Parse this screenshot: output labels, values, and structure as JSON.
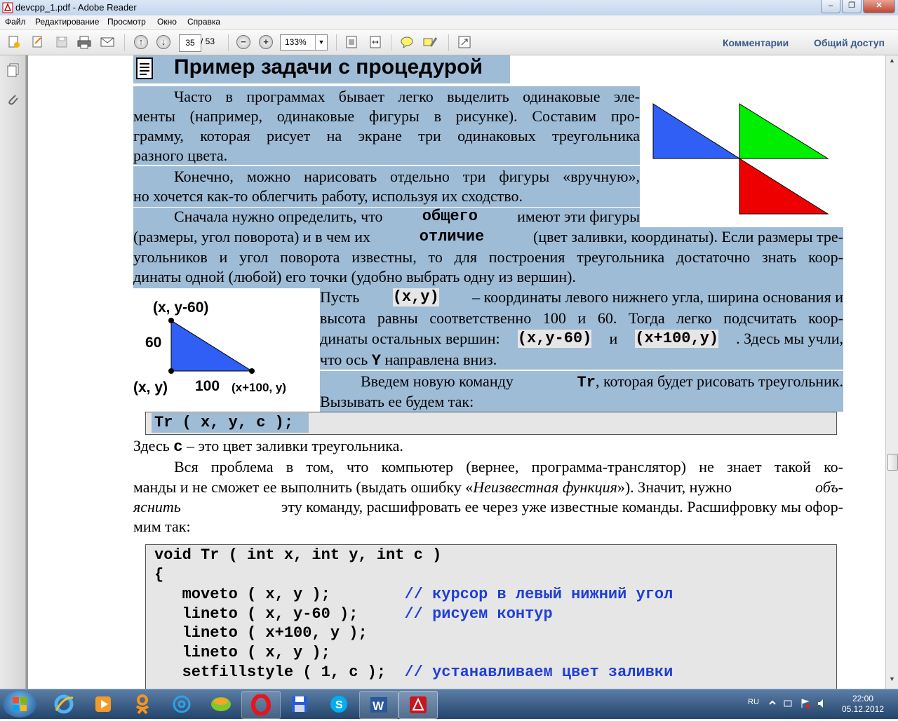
{
  "window": {
    "title": "devcpp_1.pdf - Adobe Reader"
  },
  "menu": [
    "Файл",
    "Редактирование",
    "Просмотр",
    "Окно",
    "Справка"
  ],
  "toolbar": {
    "page_current": "35",
    "page_total": "/ 53",
    "zoom": "133%",
    "comments_label": "Комментарии",
    "share_label": "Общий доступ"
  },
  "document": {
    "heading": "Пример задачи с процедурой",
    "para1": [
      "Часто  в программах бывает легко выделить одинаковые эле-",
      "менты (например, одинаковые фигуры в рисунке). Составим про-",
      "грамму, которая рисует на экране три одинаковых треугольника",
      "разного цвета."
    ],
    "para2": [
      "Конечно, можно нарисовать отдельно три фигуры «вручную»,",
      "но хочется как-то облегчить работу, используя их сходство."
    ],
    "para3": {
      "l1_a": "Сначала нужно определить, что",
      "l1_b": "общего",
      "l1_c": "имеют эти фигуры",
      "l2_a": "(размеры, угол поворота) и в чем их",
      "l2_b": "отличие",
      "l2_c": "(цвет заливки, координаты). Если размеры тре-",
      "l3": "угольников и угол поворота известны, то для построения треугольника достаточно знать коор-",
      "l4": "динаты одной (любой) его точки (удобно выбрать одну из вершин)."
    },
    "diagram": {
      "top_label": "(x, y-60)",
      "height_label": "60",
      "bl_label": "(x, y)",
      "width_label": "100",
      "br_label": "(x+100, y)"
    },
    "para4": {
      "l1_a": "Пусть",
      "l1_code": "(x,y)",
      "l1_b": "– координаты левого нижнего угла, ширина основания и",
      "l2": "высота равны соответственно 100 и 60.  Тогда легко подсчитать коор-",
      "l3_a": "динаты остальных вершин:",
      "l3_code1": "(x,y-60)",
      "l3_b": "и",
      "l3_code2": "(x+100,y)",
      "l3_c": ". Здесь мы учли,",
      "l4_a": "что ось",
      "l4_code": "Y",
      "l4_b": "направлена вниз."
    },
    "para5": {
      "l1_a": "Введем новую команду",
      "l1_code": "Tr",
      "l1_b": ", которая будет рисовать треугольник.",
      "l2": "Вызывать ее будем так:"
    },
    "call_code": "Tr ( x, y, c );",
    "para6": {
      "a": "Здесь",
      "code": "c",
      "b": "– это цвет заливки треугольника."
    },
    "para7": {
      "l1": "Вся проблема в том, что компьютер (вернее, программа-транслятор) не знает такой ко-",
      "l2_a": "манды и не сможет ее выполнить (выдать ошибку «",
      "l2_i": "Неизвестная функция",
      "l2_b": "»). Значит, нужно",
      "l2_i2": "объ-",
      "l3_i": "яснить",
      "l3_b": "эту команду, расшифровать ее через уже известные команды. Расшифровку мы офор-",
      "l4": "мим так:"
    },
    "code_lines": [
      {
        "code": "void Tr ( int x, int y, int c )",
        "comment": ""
      },
      {
        "code": "{",
        "comment": ""
      },
      {
        "code": "   moveto ( x, y );        ",
        "comment": "// курсор в левый нижний угол"
      },
      {
        "code": "   lineto ( x, y-60 );     ",
        "comment": "// рисуем контур"
      },
      {
        "code": "   lineto ( x+100, y );",
        "comment": ""
      },
      {
        "code": "   lineto ( x, y );",
        "comment": ""
      },
      {
        "code": "   setfillstyle ( 1, c );  ",
        "comment": "// устанавливаем цвет заливки"
      }
    ]
  },
  "taskbar": {
    "lang": "RU",
    "time": "22:00",
    "date": "05.12.2012"
  },
  "colors": {
    "highlight": "#9fbcd6",
    "code_comment": "#1f3fd6",
    "triangle_blue": "#2f5ff5",
    "triangle_green": "#00ee00",
    "triangle_red": "#ee0000"
  }
}
